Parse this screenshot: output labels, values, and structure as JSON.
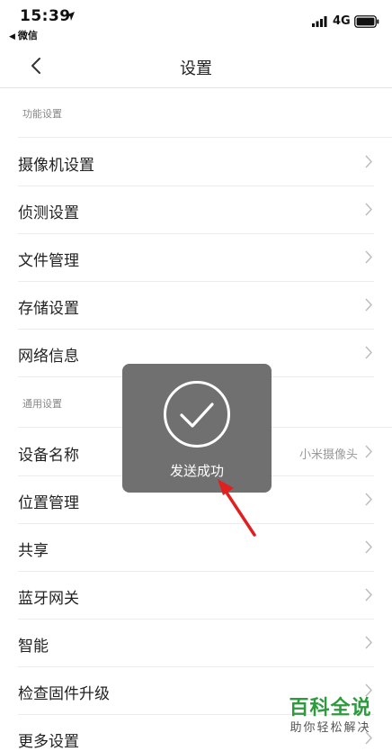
{
  "status_bar": {
    "time": "15:39",
    "back_app": "微信",
    "network": "4G"
  },
  "nav": {
    "title": "设置"
  },
  "sections": {
    "function": {
      "header": "功能设置",
      "items": [
        {
          "label": "摄像机设置"
        },
        {
          "label": "侦测设置"
        },
        {
          "label": "文件管理"
        },
        {
          "label": "存储设置"
        },
        {
          "label": "网络信息"
        }
      ]
    },
    "general": {
      "header": "通用设置",
      "items": [
        {
          "label": "设备名称",
          "value": "小米摄像头"
        },
        {
          "label": "位置管理"
        },
        {
          "label": "共享"
        },
        {
          "label": "蓝牙网关"
        },
        {
          "label": "智能"
        },
        {
          "label": "检查固件升级"
        },
        {
          "label": "更多设置"
        }
      ]
    }
  },
  "toast": {
    "message": "发送成功"
  },
  "watermark": {
    "main": "百科全说",
    "sub": "助你轻松解决"
  },
  "colors": {
    "toast_bg": "#646464",
    "annotation": "#e02020",
    "watermark": "#2e9a3e"
  }
}
